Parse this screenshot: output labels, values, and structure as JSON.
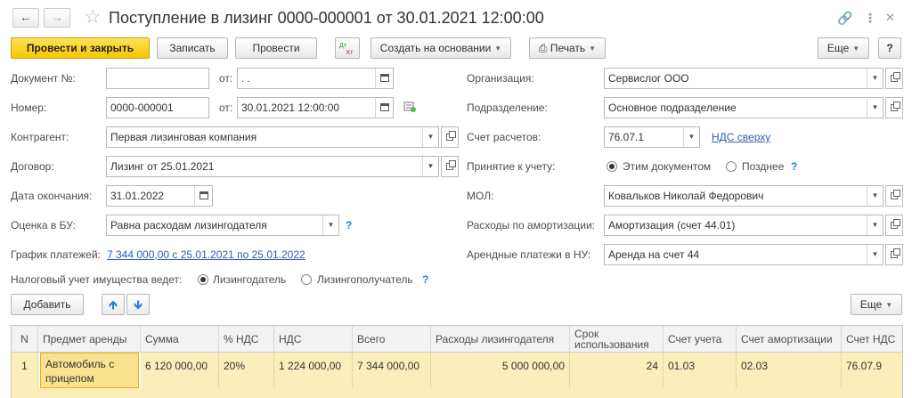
{
  "header": {
    "title": "Поступление в лизинг 0000-000001 от 30.01.2021 12:00:00"
  },
  "toolbar": {
    "post_close": "Провести и закрыть",
    "save": "Записать",
    "post": "Провести",
    "dtkt": "Дт Кт",
    "create_basis": "Создать на основании",
    "print": "Печать",
    "more": "Еще",
    "help": "?"
  },
  "form": {
    "doc_no_label": "Документ №:",
    "doc_no_value": "",
    "from_label": "от:",
    "doc_date_value": " .  .",
    "number_label": "Номер:",
    "number_value": "0000-000001",
    "date_value": "30.01.2021 12:00:00",
    "counterparty_label": "Контрагент:",
    "counterparty_value": "Первая лизинговая компания",
    "contract_label": "Договор:",
    "contract_value": "Лизинг от 25.01.2021",
    "end_date_label": "Дата окончания:",
    "end_date_value": "31.01.2022",
    "assessment_label": "Оценка в БУ:",
    "assessment_value": "Равна расходам лизингодателя",
    "schedule_label": "График платежей:",
    "schedule_link": "7 344 000,00 с 25.01.2021 по 25.01.2022",
    "tax_label": "Налоговый учет имущества ведет:",
    "tax_opt1": "Лизингодатель",
    "tax_opt2": "Лизингополучатель",
    "org_label": "Организация:",
    "org_value": "Сервислог ООО",
    "dept_label": "Подразделение:",
    "dept_value": "Основное подразделение",
    "account_label": "Счет расчетов:",
    "account_value": "76.07.1",
    "vat_link": "НДС сверху",
    "acceptance_label": "Принятие к учету:",
    "acceptance_opt1": "Этим документом",
    "acceptance_opt2": "Позднее",
    "mol_label": "МОЛ:",
    "mol_value": "Ковальков Николай Федорович",
    "depr_label": "Расходы по амортизации:",
    "depr_value": "Амортизация (счет 44.01)",
    "rent_label": "Арендные платежи в НУ:",
    "rent_value": "Аренда на счет 44"
  },
  "table_toolbar": {
    "add": "Добавить",
    "more": "Еще"
  },
  "table": {
    "headers": [
      "N",
      "Предмет аренды",
      "Сумма",
      "% НДС",
      "НДС",
      "Всего",
      "Расходы лизингодателя",
      "Срок использования",
      "Счет учета",
      "Счет амортизации",
      "Счет НДС"
    ],
    "rows": [
      [
        "1",
        "Автомобиль с прицепом",
        "6 120 000,00",
        "20%",
        "1 224 000,00",
        "7 344 000,00",
        "5 000 000,00",
        "24",
        "01.03",
        "02.03",
        "76.07.9"
      ]
    ]
  },
  "colors": {
    "primary_button": "#f6c600",
    "selected_row": "#fbeebb",
    "link": "#2a5db0"
  }
}
